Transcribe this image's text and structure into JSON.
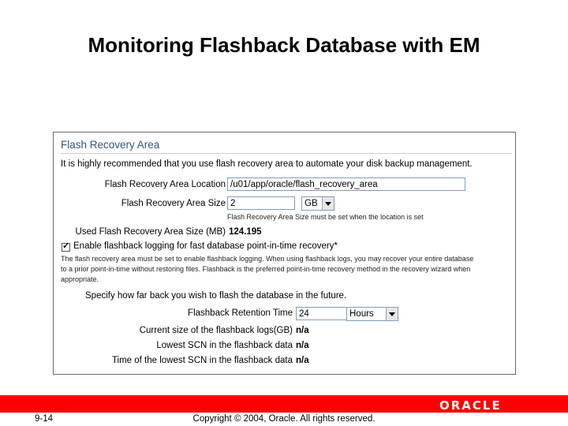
{
  "slide": {
    "title": "Monitoring Flashback Database with EM",
    "page_number": "9-14",
    "copyright": "Copyright © 2004, Oracle.  All rights reserved.",
    "logo_text": "ORACLE"
  },
  "section": {
    "title": "Flash Recovery Area",
    "intro": "It is highly recommended that you use flash recovery area to automate your disk backup management."
  },
  "form": {
    "location_label": "Flash Recovery Area Location",
    "location_value": "/u01/app/oracle/flash_recovery_area",
    "size_label": "Flash Recovery Area Size",
    "size_value": "2",
    "size_unit": "GB",
    "size_hint": "Flash Recovery Area Size must be set when the location is set",
    "used_label": "Used Flash Recovery Area Size (MB)",
    "used_value": "124.195",
    "enable_checked": true,
    "enable_label": "Enable flashback logging for fast database point-in-time recovery*",
    "enable_note_line1": "The flash recovery area must be set to enable flashback logging. When using flashback logs, you may recover your entire database",
    "enable_note_line2": "to a prior point-in-time without restoring files. Flashback is the preferred point-in-time recovery method in the recovery wizard when",
    "enable_note_line3": "appropriate.",
    "specify_text": "Specify how far back you wish to flash the database in the future.",
    "retention_label": "Flashback Retention Time",
    "retention_value": "24",
    "retention_unit": "Hours",
    "current_size_label": "Current size of the flashback logs(GB)",
    "current_size_value": "n/a",
    "lowest_scn_label": "Lowest SCN in the flashback data",
    "lowest_scn_value": "n/a",
    "lowest_time_label": "Time of the lowest SCN in the flashback data",
    "lowest_time_value": "n/a"
  },
  "colors": {
    "footer_bar": "#ff0000",
    "section_title": "#33557a"
  }
}
